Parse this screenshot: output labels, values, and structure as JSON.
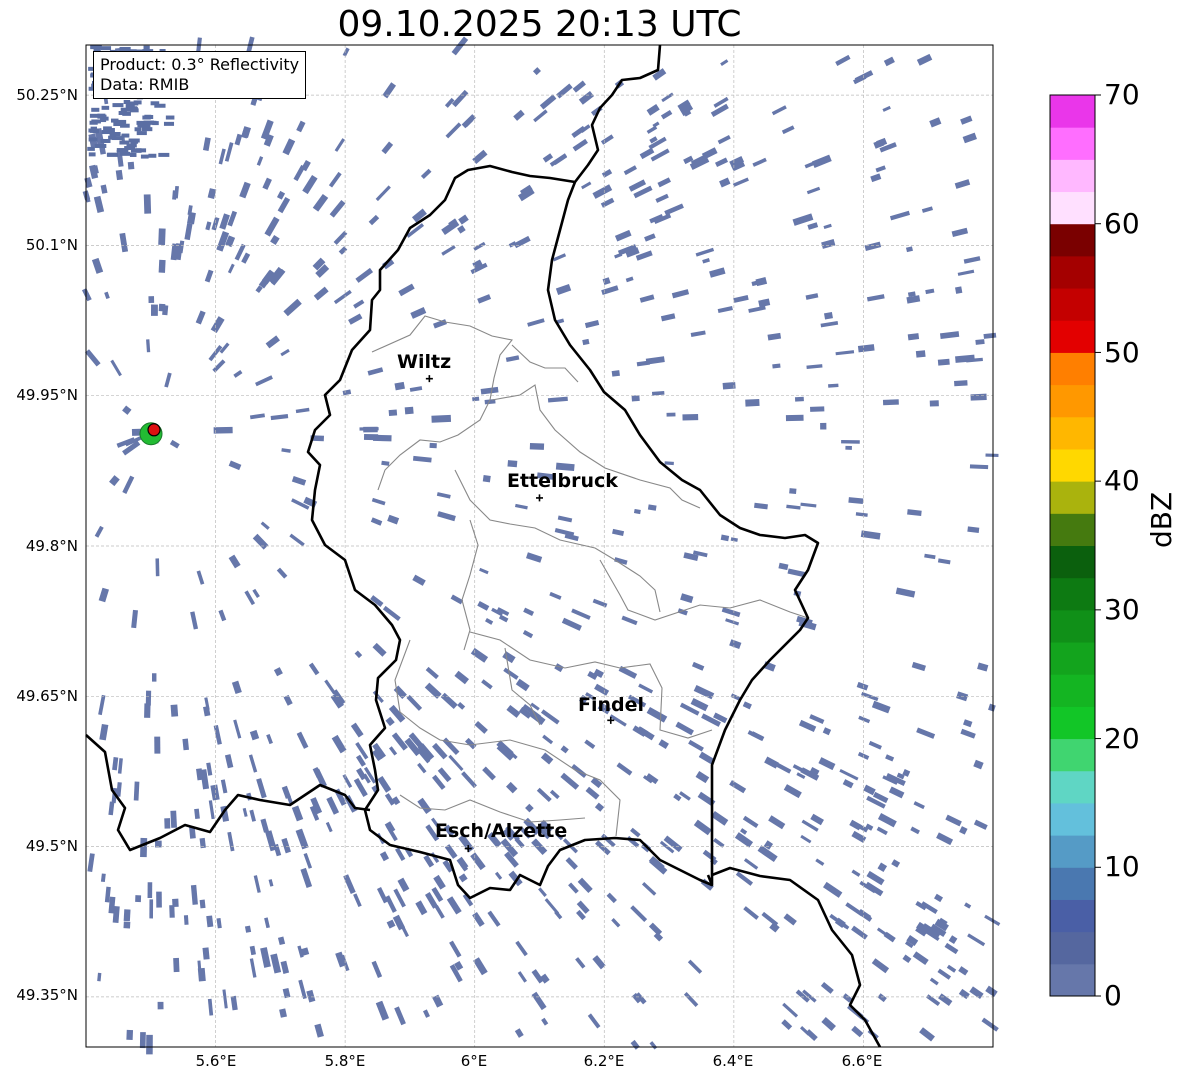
{
  "title": "09.10.2025 20:13 UTC",
  "product_box": {
    "product": "Product: 0.3° Reflectivity",
    "data": "Data: RMIB"
  },
  "map": {
    "lon_range": [
      5.4,
      6.8
    ],
    "lat_range": [
      49.3,
      50.3
    ],
    "lat_ticks": [
      "50.25°N",
      "50.1°N",
      "49.95°N",
      "49.8°N",
      "49.65°N",
      "49.5°N",
      "49.35°N"
    ],
    "lon_ticks": [
      "5.6°E",
      "5.8°E",
      "6°E",
      "6.2°E",
      "6.4°E",
      "6.6°E"
    ],
    "grid": true,
    "echo_color": "#6677aa",
    "border_color": "#000000",
    "district_color": "#888888"
  },
  "cities": [
    {
      "name": "Wiltz",
      "lon": 5.93,
      "lat": 49.967
    },
    {
      "name": "Ettelbruck",
      "lon": 6.1,
      "lat": 49.848
    },
    {
      "name": "Findel",
      "lon": 6.21,
      "lat": 49.626
    },
    {
      "name": "Esch/Alzette",
      "lon": 5.99,
      "lat": 49.498
    }
  ],
  "radar_site": {
    "lon": 5.505,
    "lat": 49.914,
    "color": "#dd1111",
    "echo_color": "#22bb33"
  },
  "colorbar": {
    "label": "dBZ",
    "ticks": [
      "0",
      "10",
      "20",
      "30",
      "40",
      "50",
      "60",
      "70"
    ],
    "vmin": 0,
    "vmax": 70,
    "step": 2.5,
    "colors": [
      "#6677aa",
      "#55679f",
      "#4a5fa6",
      "#4a78b0",
      "#559bc6",
      "#63c0dc",
      "#5fd6c4",
      "#40d570",
      "#12c627",
      "#14b522",
      "#13a41d",
      "#109018",
      "#0d7a12",
      "#0b600d",
      "#457a0f",
      "#aab30d",
      "#ffd800",
      "#ffb700",
      "#ff9800",
      "#ff7f00",
      "#e30000",
      "#c40000",
      "#a40000",
      "#7a0000",
      "#ffe0ff",
      "#ffb8ff",
      "#ff6eff",
      "#ea36ea"
    ]
  }
}
